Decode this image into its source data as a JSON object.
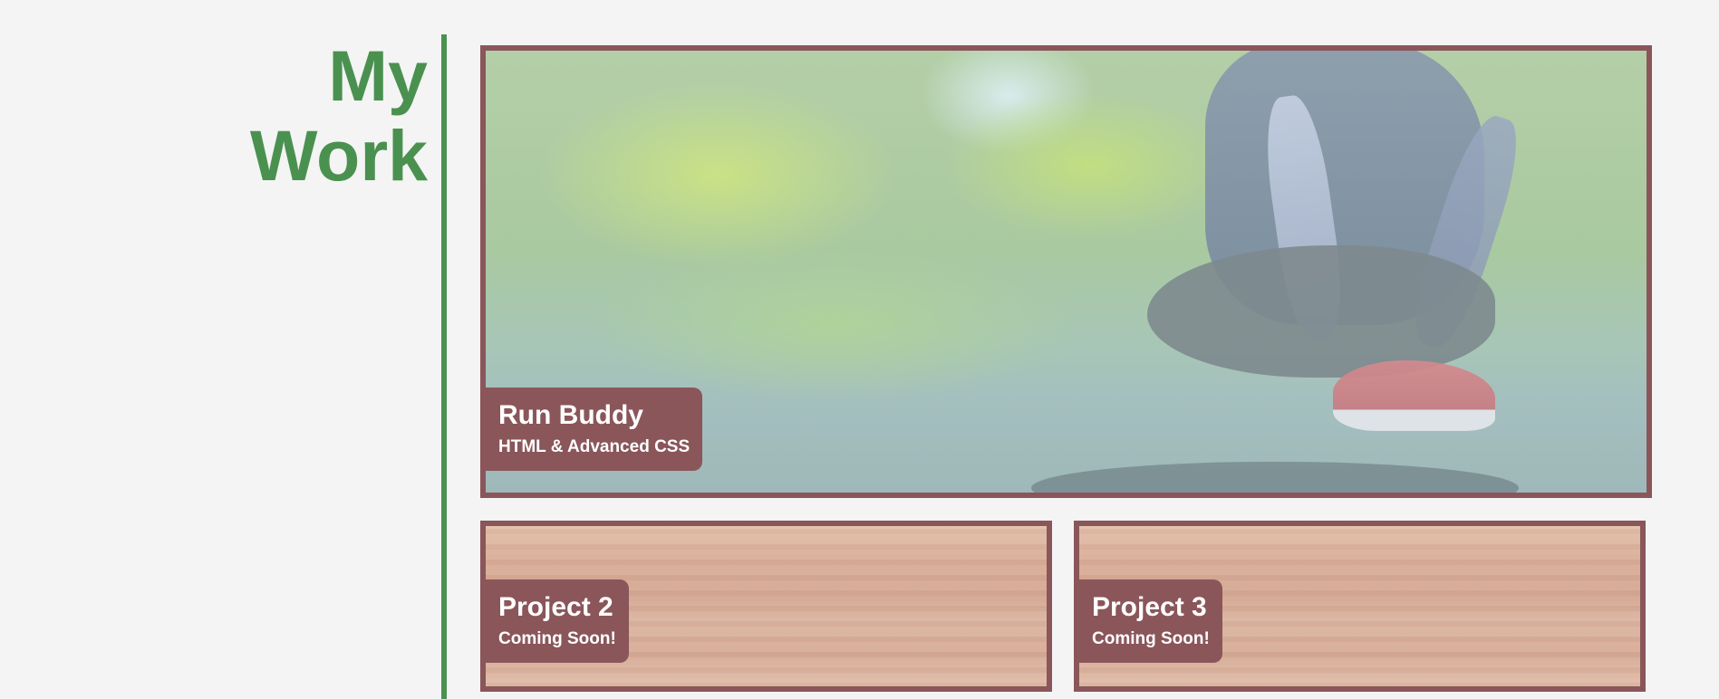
{
  "section": {
    "title_line_1": "My",
    "title_line_2": "Work"
  },
  "projects": [
    {
      "title": "Run Buddy",
      "subtitle": "HTML & Advanced CSS"
    },
    {
      "title": "Project 2",
      "subtitle": "Coming Soon!"
    },
    {
      "title": "Project 3",
      "subtitle": "Coming Soon!"
    }
  ],
  "colors": {
    "accent_green": "#4a9150",
    "label_background": "#8a565a",
    "page_background": "#f4f4f4"
  }
}
